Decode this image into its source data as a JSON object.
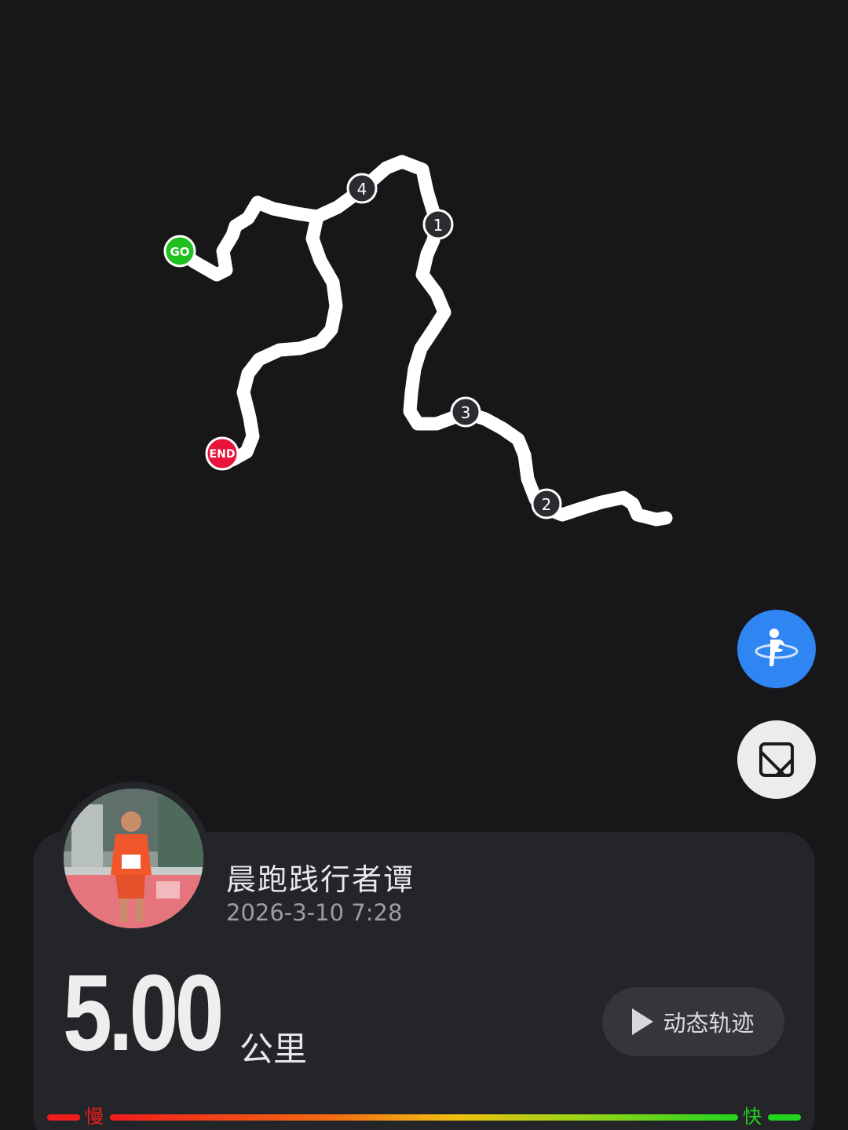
{
  "map": {
    "start_marker": "GO",
    "end_marker": "END",
    "km_markers": [
      "1",
      "2",
      "3",
      "4"
    ],
    "route_color": "#ffffff",
    "start_color": "#1fc01f",
    "end_color": "#e8143c"
  },
  "controls": {
    "runner_button_icon": "runner-icon",
    "layer_button_icon": "map-layer-icon",
    "runner_button_color": "#2f86f3"
  },
  "user": {
    "name": "晨跑践行者谭",
    "date": "2026-3-10 7:28"
  },
  "run": {
    "distance": "5.00",
    "unit": "公里"
  },
  "replay_button": {
    "label": "动态轨迹",
    "icon": "play-icon"
  },
  "pace_legend": {
    "slow_label": "慢",
    "fast_label": "快",
    "slow_color": "#f01c1c",
    "fast_color": "#22d41e"
  }
}
